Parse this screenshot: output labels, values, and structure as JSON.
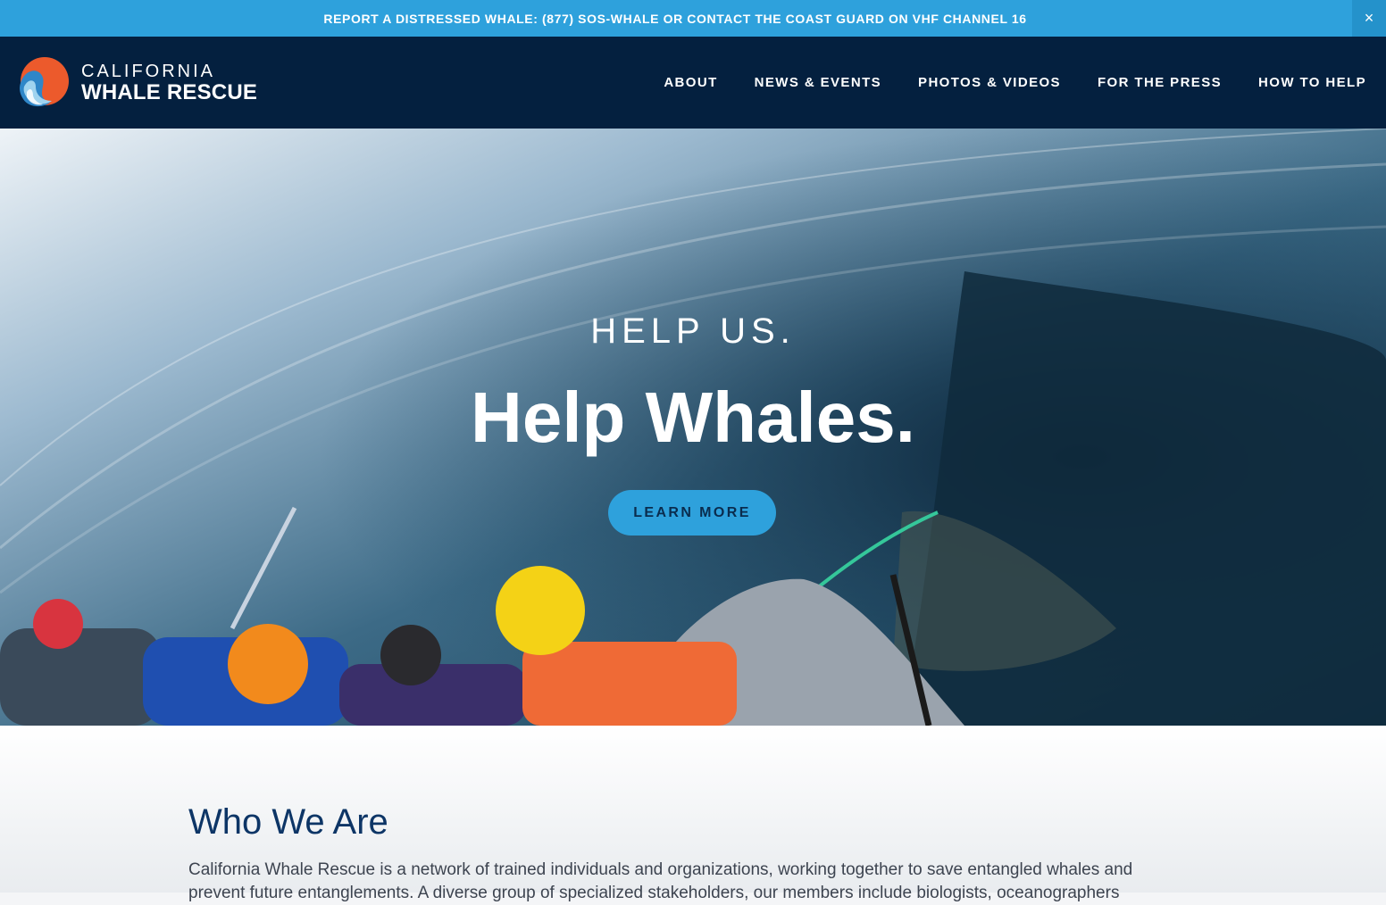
{
  "alert": {
    "text": "REPORT A DISTRESSED WHALE: (877) SOS-WHALE OR CONTACT THE COAST GUARD ON VHF CHANNEL 16",
    "close_label": "×"
  },
  "header": {
    "logo_top": "CALIFORNIA",
    "logo_bottom": "WHALE RESCUE",
    "nav": [
      "ABOUT",
      "NEWS & EVENTS",
      "PHOTOS & VIDEOS",
      "FOR THE PRESS",
      "HOW TO HELP"
    ]
  },
  "hero": {
    "eyebrow": "HELP US.",
    "title": "Help Whales.",
    "cta_label": "LEARN MORE"
  },
  "about": {
    "title": "Who We Are",
    "body": "California Whale Rescue is a network of trained individuals and organizations, working together to save entangled whales and prevent future entanglements. A diverse group of specialized stakeholders, our members include biologists, oceanographers"
  },
  "colors": {
    "alert_bg": "#2ea1dc",
    "header_bg": "#04203f",
    "cta_bg": "#2ea1dc",
    "heading_blue": "#0d3566",
    "logo_orange": "#ec5a2c"
  },
  "icons": {
    "logo": "whale-wave-logo-icon",
    "close": "close-icon"
  }
}
